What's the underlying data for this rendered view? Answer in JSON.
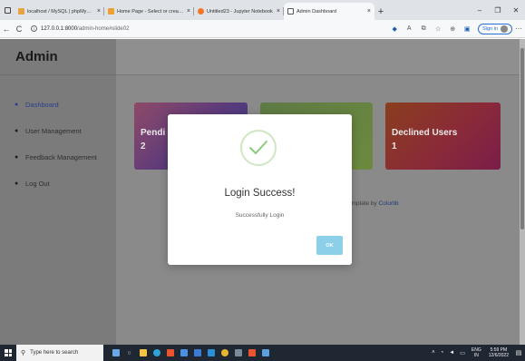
{
  "browser": {
    "tabs": [
      {
        "label": "localhost / MySQL | phpMyAdmi",
        "favicon_color": "#e8a33d",
        "active": false
      },
      {
        "label": "Home Page - Select or create a",
        "favicon_color": "#f0a030",
        "active": false
      },
      {
        "label": "Untitled23 - Jupyter Notebook",
        "favicon_color": "#f37626",
        "active": false
      },
      {
        "label": "Admin Dashboard",
        "favicon_color": "#ffffff",
        "active": true
      }
    ],
    "tab_close": "×",
    "new_tab": "+",
    "window_controls": {
      "minimize": "–",
      "restore": "❐",
      "close": "✕"
    },
    "nav": {
      "back": "←",
      "refresh": "C"
    },
    "url": {
      "info_icon": "i",
      "host": "127.0.0.1:8000",
      "path": "/admin-home#slide02"
    },
    "signin_label": "Sign in",
    "more": "···"
  },
  "sidebar": {
    "brand": "Admin",
    "items": [
      {
        "label": "Dashboard",
        "active": true
      },
      {
        "label": "User Management",
        "active": false
      },
      {
        "label": "Feedback Management",
        "active": false
      },
      {
        "label": "Log Out",
        "active": false
      }
    ]
  },
  "cards": [
    {
      "title": "Pendi",
      "value": "2"
    },
    {
      "title": "",
      "value": ""
    },
    {
      "title": "Declined Users",
      "value": "1"
    }
  ],
  "footer": {
    "text": "emplate by",
    "link": "Colorlib"
  },
  "modal": {
    "title": "Login Success!",
    "message": "Successfully Login",
    "ok_label": "OK",
    "success_color": "#8cc97a"
  },
  "taskbar": {
    "search_placeholder": "Type here to search",
    "language": {
      "line1": "ENG",
      "line2": "IN"
    },
    "time": "5:59 PM",
    "date": "12/6/2022"
  }
}
